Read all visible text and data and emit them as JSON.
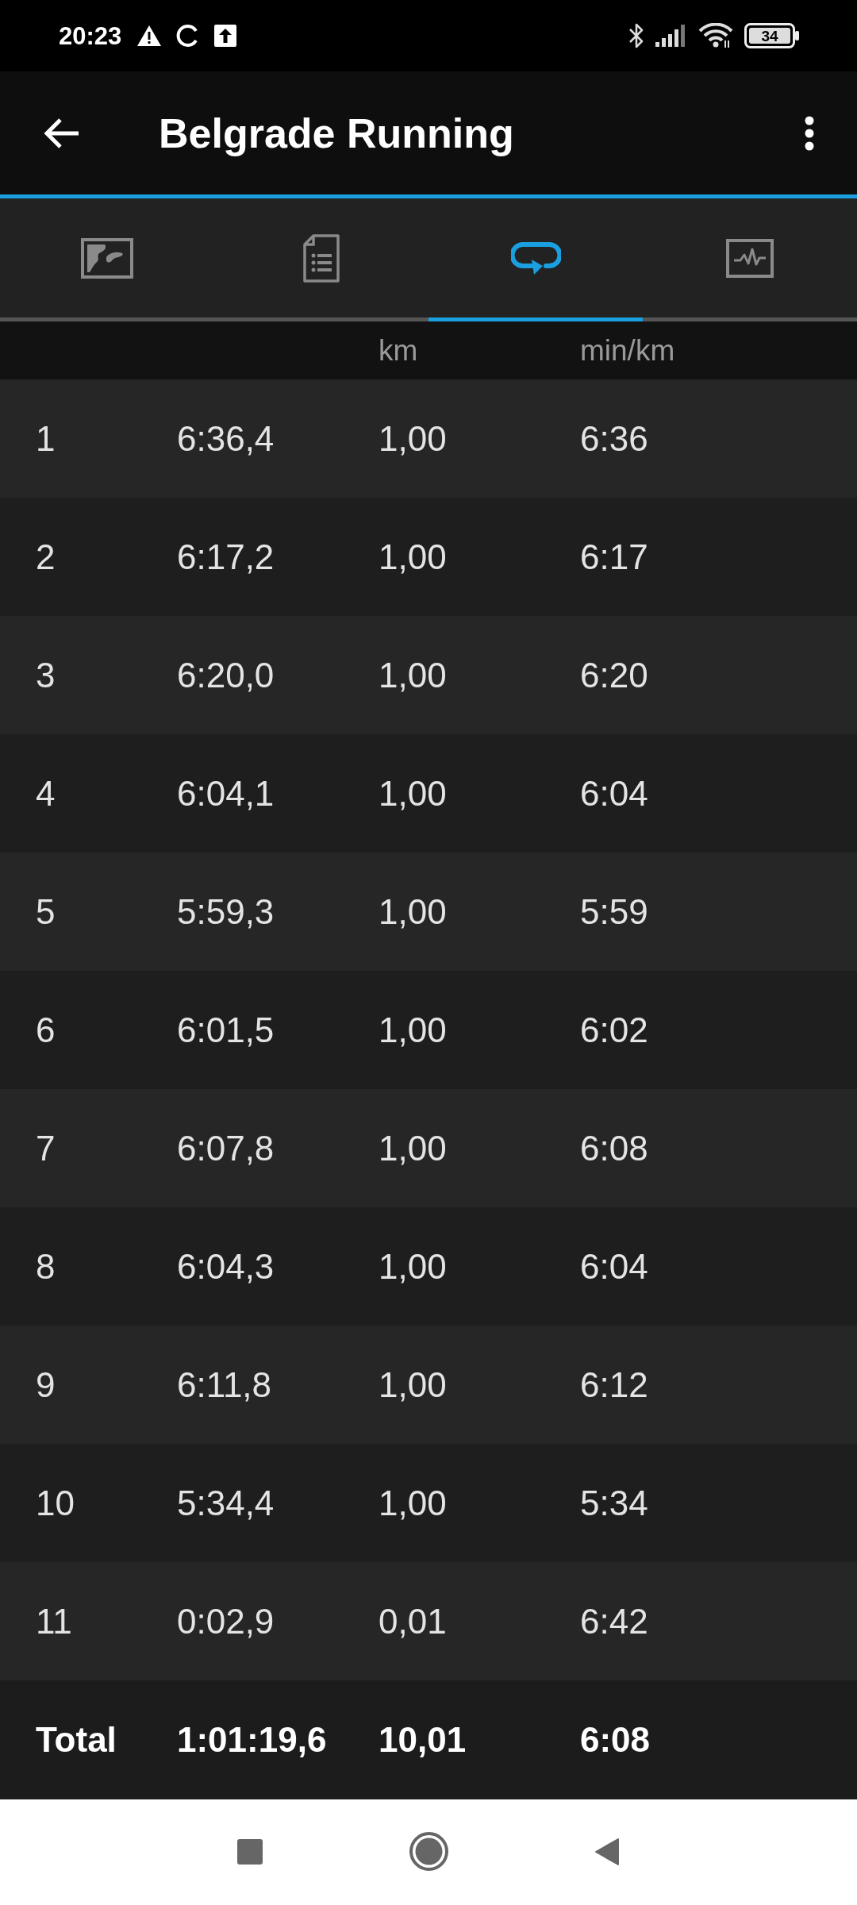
{
  "status_bar": {
    "time": "20:23",
    "battery": "34"
  },
  "app_bar": {
    "title": "Belgrade Running"
  },
  "tabs": [
    {
      "kind": "map",
      "selected": false
    },
    {
      "kind": "summary",
      "selected": false
    },
    {
      "kind": "laps",
      "selected": true
    },
    {
      "kind": "chart",
      "selected": false
    }
  ],
  "table": {
    "column_headings": {
      "column_3": "km",
      "column_4": "min/km"
    },
    "rows": [
      {
        "cells": [
          "1",
          "6:36,4",
          "1,00",
          "6:36"
        ]
      },
      {
        "cells": [
          "2",
          "6:17,2",
          "1,00",
          "6:17"
        ]
      },
      {
        "cells": [
          "3",
          "6:20,0",
          "1,00",
          "6:20"
        ]
      },
      {
        "cells": [
          "4",
          "6:04,1",
          "1,00",
          "6:04"
        ]
      },
      {
        "cells": [
          "5",
          "5:59,3",
          "1,00",
          "5:59"
        ]
      },
      {
        "cells": [
          "6",
          "6:01,5",
          "1,00",
          "6:02"
        ]
      },
      {
        "cells": [
          "7",
          "6:07,8",
          "1,00",
          "6:08"
        ]
      },
      {
        "cells": [
          "8",
          "6:04,3",
          "1,00",
          "6:04"
        ]
      },
      {
        "cells": [
          "9",
          "6:11,8",
          "1,00",
          "6:12"
        ]
      },
      {
        "cells": [
          "10",
          "5:34,4",
          "1,00",
          "5:34"
        ]
      },
      {
        "cells": [
          "11",
          "0:02,9",
          "0,01",
          "6:42"
        ]
      }
    ],
    "total": {
      "cells": [
        "Total",
        "1:01:19,6",
        "10,01",
        "6:08"
      ]
    }
  }
}
